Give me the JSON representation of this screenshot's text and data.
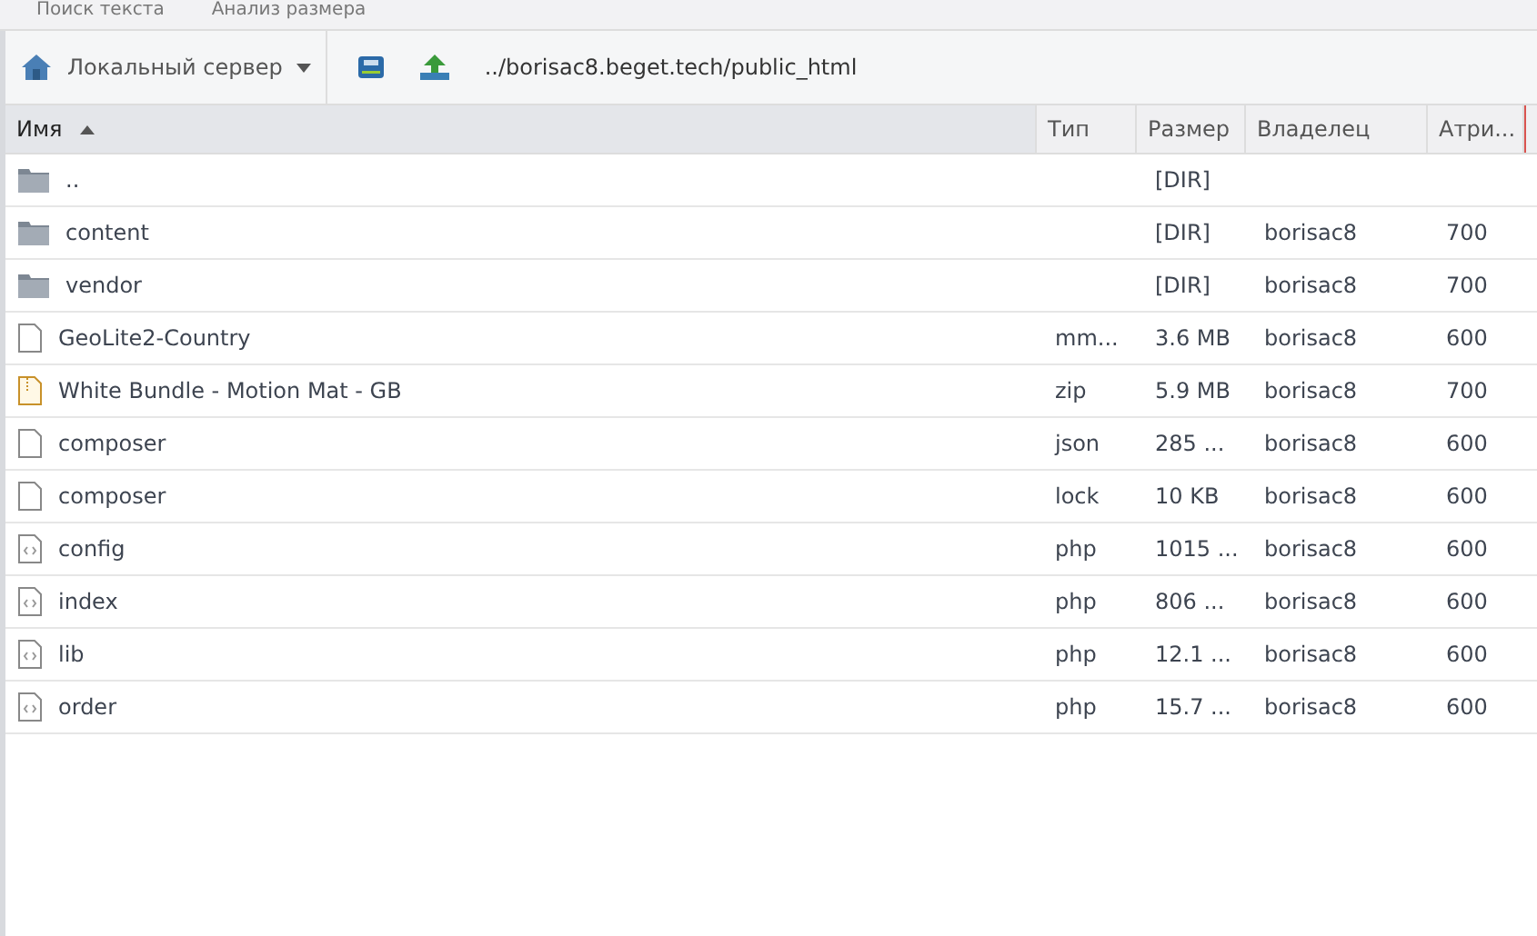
{
  "menu": [
    "Поиск текста",
    "Анализ размера"
  ],
  "toolbar": {
    "server": "Локальный сервер",
    "path": "../borisac8.beget.tech/public_html"
  },
  "table": {
    "columns": [
      {
        "label": "Имя",
        "sorted": true
      },
      {
        "label": "Тип",
        "sorted": false
      },
      {
        "label": "Размер",
        "sorted": false
      },
      {
        "label": "Владелец",
        "sorted": false
      },
      {
        "label": "Атри...",
        "sorted": false
      }
    ],
    "rows": [
      {
        "kind": "folder",
        "name": "..",
        "type": "",
        "size": "[DIR]",
        "owner": "",
        "attrs": ""
      },
      {
        "kind": "folder",
        "name": "content",
        "type": "",
        "size": "[DIR]",
        "owner": "borisac8",
        "attrs": "700"
      },
      {
        "kind": "folder",
        "name": "vendor",
        "type": "",
        "size": "[DIR]",
        "owner": "borisac8",
        "attrs": "700"
      },
      {
        "kind": "file",
        "name": "GeoLite2-Country",
        "type": "mm...",
        "size": "3.6 MB",
        "owner": "borisac8",
        "attrs": "600"
      },
      {
        "kind": "archive",
        "name": "White Bundle - Motion Mat - GB",
        "type": "zip",
        "size": "5.9 MB",
        "owner": "borisac8",
        "attrs": "700"
      },
      {
        "kind": "file",
        "name": "composer",
        "type": "json",
        "size": "285 ...",
        "owner": "borisac8",
        "attrs": "600"
      },
      {
        "kind": "file",
        "name": "composer",
        "type": "lock",
        "size": "10 KB",
        "owner": "borisac8",
        "attrs": "600"
      },
      {
        "kind": "code",
        "name": "config",
        "type": "php",
        "size": "1015 ...",
        "owner": "borisac8",
        "attrs": "600"
      },
      {
        "kind": "code",
        "name": "index",
        "type": "php",
        "size": "806 ...",
        "owner": "borisac8",
        "attrs": "600"
      },
      {
        "kind": "code",
        "name": "lib",
        "type": "php",
        "size": "12.1 ...",
        "owner": "borisac8",
        "attrs": "600"
      },
      {
        "kind": "code",
        "name": "order",
        "type": "php",
        "size": "15.7 ...",
        "owner": "borisac8",
        "attrs": "600"
      }
    ]
  }
}
